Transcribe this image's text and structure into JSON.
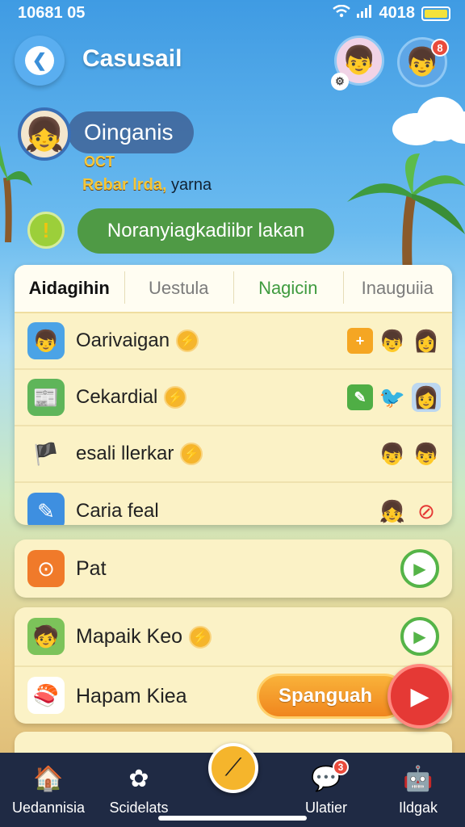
{
  "status_bar": {
    "time": "10681 05",
    "battery_text": "4018"
  },
  "header": {
    "title": "Casusail"
  },
  "profile": {
    "name": "Oinganis",
    "sub1": "OCT",
    "sub2": "Rebar lrda,",
    "sub2_suffix": "yarna"
  },
  "alert": {
    "text": "Noranyiagkadiibr lakan"
  },
  "tabs": [
    "Aidagihin",
    "Uestula",
    "Nagicin",
    "Inauguiia"
  ],
  "list": [
    {
      "label": "Oarivaigan",
      "icon": "boy-avatar-icon"
    },
    {
      "label": "Cekardial",
      "icon": "newspaper-icon"
    },
    {
      "label": "esali llerkar",
      "icon": "pirate-icon"
    },
    {
      "label": "Caria feal",
      "icon": "pen-icon"
    }
  ],
  "lower_items": [
    {
      "label": "Pat",
      "icon": "orange-app-icon"
    },
    {
      "label": "Mapaik Keo",
      "icon": "kid-app-icon"
    },
    {
      "label": "Hapam Kiea",
      "icon": "sushi-icon"
    }
  ],
  "cta": {
    "label": "Spanguah"
  },
  "nav": [
    {
      "label": "Uedannisia",
      "icon": "home-icon"
    },
    {
      "label": "Scidelats",
      "icon": "flower-icon"
    },
    {
      "label": "Ulatier",
      "icon": "bubble-icon",
      "badge": "3"
    },
    {
      "label": "Ildgak",
      "icon": "robot-icon"
    }
  ],
  "notif_badge": "8"
}
